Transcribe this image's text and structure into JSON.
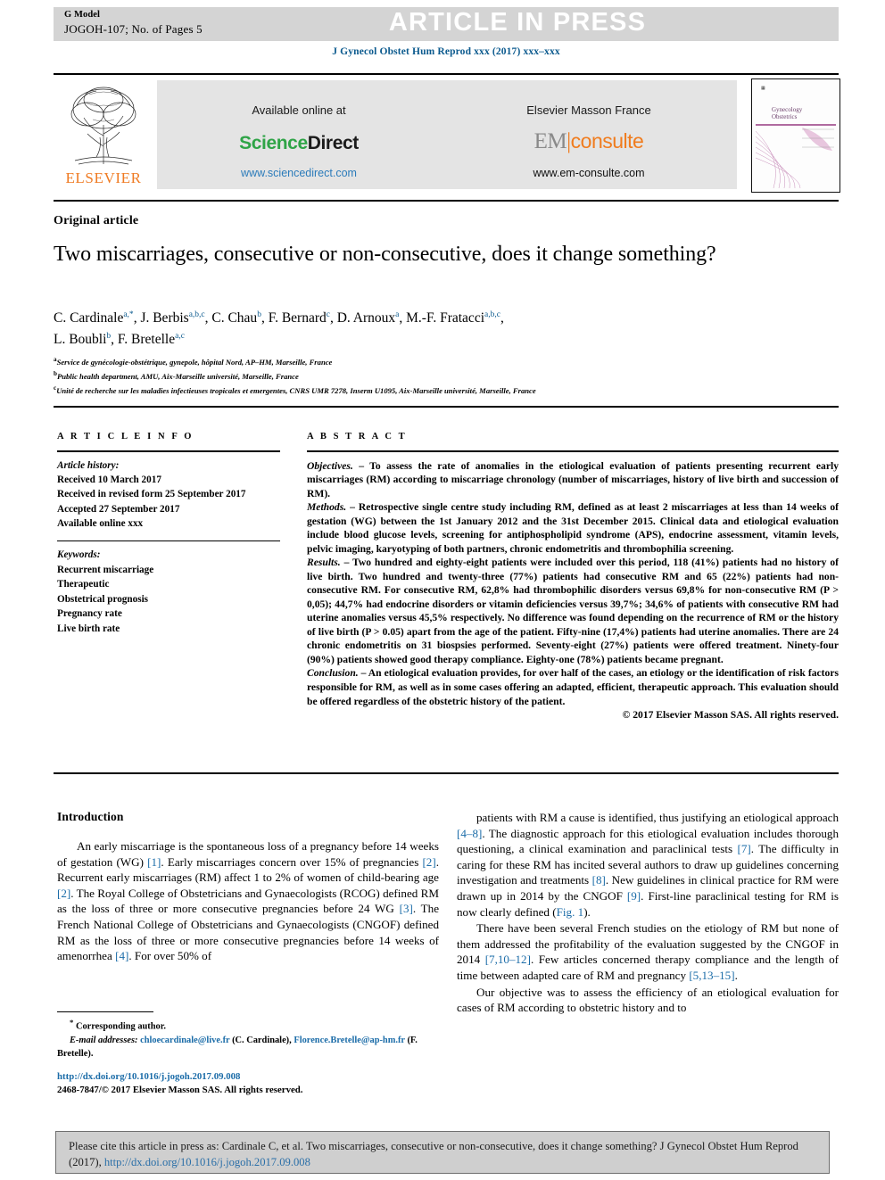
{
  "header": {
    "g_model": "G Model",
    "manuscript_id": "JOGOH-107; No. of Pages 5",
    "article_in_press": "ARTICLE IN PRESS",
    "journal_line": "J Gynecol Obstet Hum Reprod xxx (2017) xxx–xxx"
  },
  "masthead": {
    "publisher_logo_text": "ELSEVIER",
    "available_online_at": "Available online at",
    "sciencedirect_part1": "Science",
    "sciencedirect_part2": "Direct",
    "sciencedirect_url": "www.sciencedirect.com",
    "elsevier_masson": "Elsevier Masson France",
    "em_part1": "EM",
    "em_divider": "|",
    "em_part2": "consulte",
    "em_url": "www.em-consulte.com",
    "cover_journal_line1": "Gynecology",
    "cover_journal_line2": "Obstetrics",
    "cover_top_tiny": "ELSEVIER\nMASSON"
  },
  "article": {
    "type": "Original article",
    "title": "Two miscarriages, consecutive or non-consecutive, does it change something?",
    "authors_line1_html": "C. Cardinale<sup>a,*</sup>, J. Berbis<sup>a,b,c</sup>, C. Chau<sup>b</sup>, F. Bernard<sup>c</sup>, D. Arnoux<sup>a</sup>, M.-F. Fratacci<sup>a,b,c</sup>,",
    "authors_line2_html": "L. Boubli<sup>b</sup>, F. Bretelle<sup>a,c</sup>",
    "affiliations": [
      "Service de gynécologie-obstétrique, gynepole, hôpital Nord, AP–HM, Marseille, France",
      "Public health department, AMU, Aix-Marseille université, Marseille, France",
      "Unité de recherche sur les maladies infectieuses tropicales et emergentes, CNRS UMR 7278, Inserm U1095, Aix-Marseille université, Marseille, France"
    ],
    "affiliation_marks": [
      "a",
      "b",
      "c"
    ]
  },
  "article_info": {
    "section_label": "A R T I C L E   I N F O",
    "history_label": "Article history:",
    "history": [
      "Received 10 March 2017",
      "Received in revised form 25 September 2017",
      "Accepted 27 September 2017",
      "Available online xxx"
    ],
    "keywords_label": "Keywords:",
    "keywords": [
      "Recurrent miscarriage",
      "Therapeutic",
      "Obstetrical prognosis",
      "Pregnancy rate",
      "Live birth rate"
    ]
  },
  "abstract": {
    "section_label": "A B S T R A C T",
    "objectives_lead": "Objectives.",
    "objectives_text": " – To assess the rate of anomalies in the etiological evaluation of patients presenting recurrent early miscarriages (RM) according to miscarriage chronology (number of miscarriages, history of live birth and succession of RM).",
    "methods_lead": "Methods.",
    "methods_text": " – Retrospective single centre study including RM, defined as at least 2 miscarriages at less than 14 weeks of gestation (WG) between the 1st January 2012 and the 31st December 2015. Clinical data and etiological evaluation include blood glucose levels, screening for antiphospholipid syndrome (APS), endocrine assessment, vitamin levels, pelvic imaging, karyotyping of both partners, chronic endometritis and thrombophilia screening.",
    "results_lead": "Results.",
    "results_text": " – Two hundred and eighty-eight patients were included over this period, 118 (41%) patients had no history of live birth. Two hundred and twenty-three (77%) patients had consecutive RM and 65 (22%) patients had non-consecutive RM. For consecutive RM, 62,8% had thrombophilic disorders versus 69,8% for non-consecutive RM (P > 0,05); 44,7% had endocrine disorders or vitamin deficiencies versus 39,7%; 34,6% of patients with consecutive RM had uterine anomalies versus 45,5% respectively. No difference was found depending on the recurrence of RM or the history of live birth (P > 0.05) apart from the age of the patient. Fifty-nine (17,4%) patients had uterine anomalies. There are 24 chronic endometritis on 31 biospsies performed. Seventy-eight (27%) patients were offered treatment. Ninety-four (90%) patients showed good therapy compliance. Eighty-one (78%) patients became pregnant.",
    "conclusion_lead": "Conclusion.",
    "conclusion_text": " – An etiological evaluation provides, for over half of the cases, an etiology or the identification of risk factors responsible for RM, as well as in some cases offering an adapted, efficient, therapeutic approach. This evaluation should be offered regardless of the obstetric history of the patient.",
    "copyright": "© 2017 Elsevier Masson SAS. All rights reserved."
  },
  "body": {
    "intro_heading": "Introduction",
    "left_paragraph_1_html": "An early miscarriage is the spontaneous loss of a pregnancy before 14 weeks of gestation (WG) <span class=\"ref\">[1]</span>. Early miscarriages concern over 15% of pregnancies <span class=\"ref\">[2]</span>. Recurrent early miscarriages (RM) affect 1 to 2% of women of child-bearing age <span class=\"ref\">[2]</span>. The Royal College of Obstetricians and Gynaecologists (RCOG) defined RM as the loss of three or more consecutive pregnancies before 24 WG <span class=\"ref\">[3]</span>. The French National College of Obstetricians and Gynaecologists (CNGOF) defined RM as the loss of three or more consecutive pregnancies before 14 weeks of amenorrhea <span class=\"ref\">[4]</span>. For over 50% of",
    "right_paragraph_1_html": "patients with RM a cause is identified, thus justifying an etiological approach <span class=\"ref\">[4–8]</span>. The diagnostic approach for this etiological evaluation includes thorough questioning, a clinical examination and paraclinical tests <span class=\"ref\">[7]</span>. The difficulty in caring for these RM has incited several authors to draw up guidelines concerning investigation and treatments <span class=\"ref\">[8]</span>. New guidelines in clinical practice for RM were drawn up in 2014 by the CNGOF <span class=\"ref\">[9]</span>. First-line paraclinical testing for RM is now clearly defined (<span class=\"ref\">Fig. 1</span>).",
    "right_paragraph_2_html": "There have been several French studies on the etiology of RM but none of them addressed the profitability of the evaluation suggested by the CNGOF in 2014 <span class=\"ref\">[7,10–12]</span>. Few articles concerned therapy compliance and the length of time between adapted care of RM and pregnancy <span class=\"ref\">[5,13–15]</span>.",
    "right_paragraph_3_html": "Our objective was to assess the efficiency of an etiological evaluation for cases of RM according to obstetric history and to"
  },
  "footnote": {
    "star": "*",
    "corresponding_author": "Corresponding author.",
    "email_label": "E-mail addresses:",
    "email_1": "chloecardinale@live.fr",
    "email_1_owner": " (C. Cardinale),",
    "email_2": "Florence.Bretelle@ap-hm.fr",
    "email_2_owner": " (F. Bretelle)."
  },
  "doi_block": {
    "doi_url": "http://dx.doi.org/10.1016/j.jogoh.2017.09.008",
    "issn_line": "2468-7847/© 2017 Elsevier Masson SAS. All rights reserved."
  },
  "cite_box": {
    "text_part1": "Please cite this article in press as: Cardinale C, et al. Two miscarriages, consecutive or non-consecutive, does it change something? J Gynecol Obstet Hum Reprod (2017), ",
    "link": "http://dx.doi.org/10.1016/j.jogoh.2017.09.008"
  },
  "colors": {
    "link_blue": "#1b6ca8",
    "journal_blue": "#0b5a8e",
    "elsevier_orange": "#ef7b23",
    "sciencedirect_green": "#2fa447",
    "banner_grey": "#d4d4d4",
    "cite_box_grey": "#cfcfcf"
  }
}
